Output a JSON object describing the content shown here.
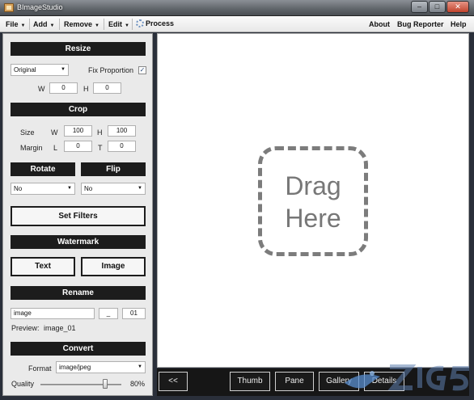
{
  "window": {
    "title": "BImageStudio",
    "minimize": "–",
    "maximize": "□",
    "close": "✕"
  },
  "menu": {
    "file": "File",
    "add": "Add",
    "remove": "Remove",
    "edit": "Edit",
    "process": "Process",
    "about": "About",
    "bug_reporter": "Bug Reporter",
    "help": "Help"
  },
  "resize": {
    "header": "Resize",
    "mode": "Original",
    "fix_proportion_label": "Fix Proportion",
    "fix_proportion_checked": true,
    "w_label": "W",
    "w_value": "0",
    "h_label": "H",
    "h_value": "0"
  },
  "crop": {
    "header": "Crop",
    "size_label": "Size",
    "w_label": "W",
    "w_value": "100",
    "h_label": "H",
    "h_value": "100",
    "margin_label": "Margin",
    "l_label": "L",
    "l_value": "0",
    "t_label": "T",
    "t_value": "0"
  },
  "rotate": {
    "header": "Rotate",
    "value": "No"
  },
  "flip": {
    "header": "Flip",
    "value": "No"
  },
  "filters": {
    "button": "Set Filters"
  },
  "watermark": {
    "header": "Watermark",
    "text_button": "Text",
    "image_button": "Image"
  },
  "rename": {
    "header": "Rename",
    "name_value": "image",
    "separator_value": "_",
    "number_value": "01",
    "preview_label": "Preview:",
    "preview_value": "image_01"
  },
  "convert": {
    "header": "Convert",
    "format_label": "Format",
    "format_value": "image/jpeg",
    "quality_label": "Quality",
    "quality_value": "80%",
    "quality_level": 0.8
  },
  "drop_area": {
    "line1": "Drag",
    "line2": "Here"
  },
  "bottom_bar": {
    "back": "<<",
    "thumb": "Thumb",
    "pane": "Pane",
    "gallery": "Gallery",
    "details": "Details"
  },
  "colors": {
    "header_bg": "#1c1c1c",
    "panel_bg": "#eaeaea",
    "drop_border": "#7c7c7c",
    "bottom_bg": "#161616"
  }
}
